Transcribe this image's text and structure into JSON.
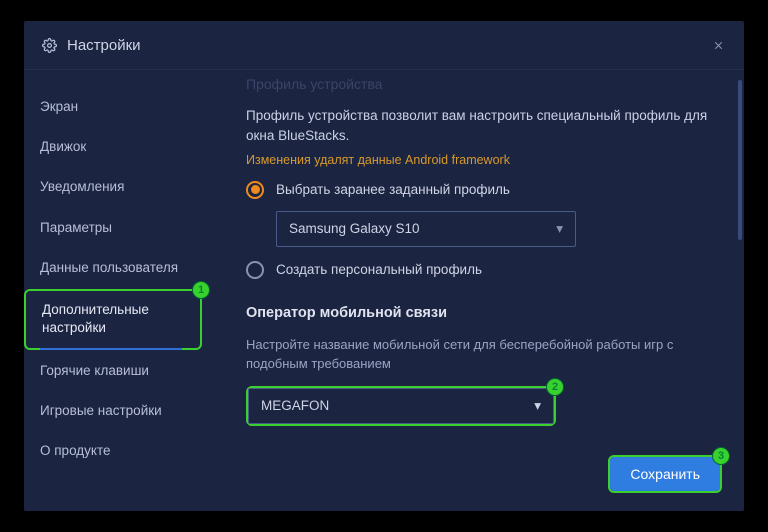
{
  "title": "Настройки",
  "sidebar": {
    "items": [
      {
        "label": "Экран"
      },
      {
        "label": "Движок"
      },
      {
        "label": "Уведомления"
      },
      {
        "label": "Параметры"
      },
      {
        "label": "Данные пользователя"
      },
      {
        "label": "Дополнительные настройки"
      },
      {
        "label": "Горячие клавиши"
      },
      {
        "label": "Игровые настройки"
      },
      {
        "label": "О продукте"
      }
    ]
  },
  "content": {
    "faded_heading": "Профиль устройства",
    "profile_desc": "Профиль устройства позволит вам настроить специальный профиль для окна BlueStacks.",
    "warning": "Изменения удалят данные Android framework",
    "radio_predefined": "Выбрать заранее заданный профиль",
    "radio_custom": "Создать персональный профиль",
    "device_selected": "Samsung Galaxy S10",
    "operator_heading": "Оператор мобильной связи",
    "operator_hint": "Настройте название мобильной сети для бесперебойной работы игр с подобным требованием",
    "operator_selected": "MEGAFON",
    "save_label": "Сохранить"
  },
  "badges": {
    "b1": "1",
    "b2": "2",
    "b3": "3"
  }
}
